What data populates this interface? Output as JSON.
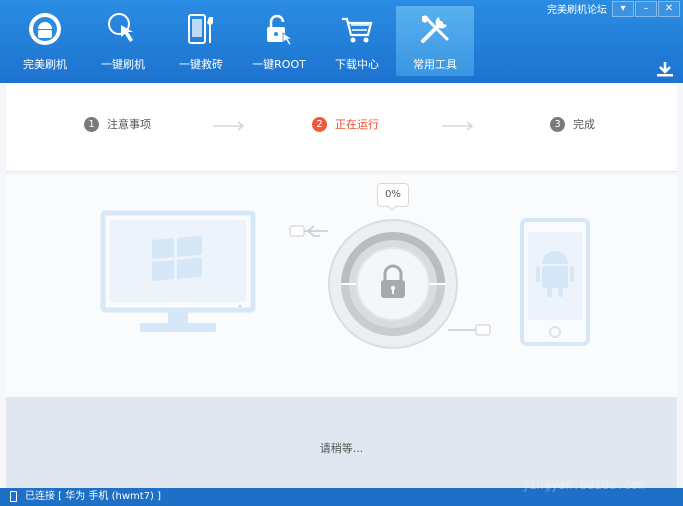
{
  "window": {
    "forum_link": "完美刷机论坛",
    "btn_menu": "▾",
    "btn_min": "–",
    "btn_close": "✕"
  },
  "nav": [
    {
      "label": "完美刷机",
      "icon": "android-icon",
      "active": false
    },
    {
      "label": "一键刷机",
      "icon": "touch-icon",
      "active": false
    },
    {
      "label": "一键救砖",
      "icon": "repair-phone-icon",
      "active": false
    },
    {
      "label": "一键ROOT",
      "icon": "unlock-icon",
      "active": false
    },
    {
      "label": "下载中心",
      "icon": "cart-icon",
      "active": false
    },
    {
      "label": "常用工具",
      "icon": "tools-icon",
      "active": true
    }
  ],
  "steps": [
    {
      "num": "1",
      "label": "注意事项"
    },
    {
      "num": "2",
      "label": "正在运行"
    },
    {
      "num": "3",
      "label": "完成"
    }
  ],
  "progress": {
    "percent_text": "0%",
    "value": 0
  },
  "bottom": {
    "wait_text": "请稍等..."
  },
  "status": {
    "connection_text": "已连接 [ 华为 手机 (hwmt7) ]"
  },
  "watermark": "jingyan.baidu.com",
  "colors": {
    "brand": "#1c73cf",
    "active_step": "#f05a3c",
    "idle_step": "#7a7a7a"
  }
}
